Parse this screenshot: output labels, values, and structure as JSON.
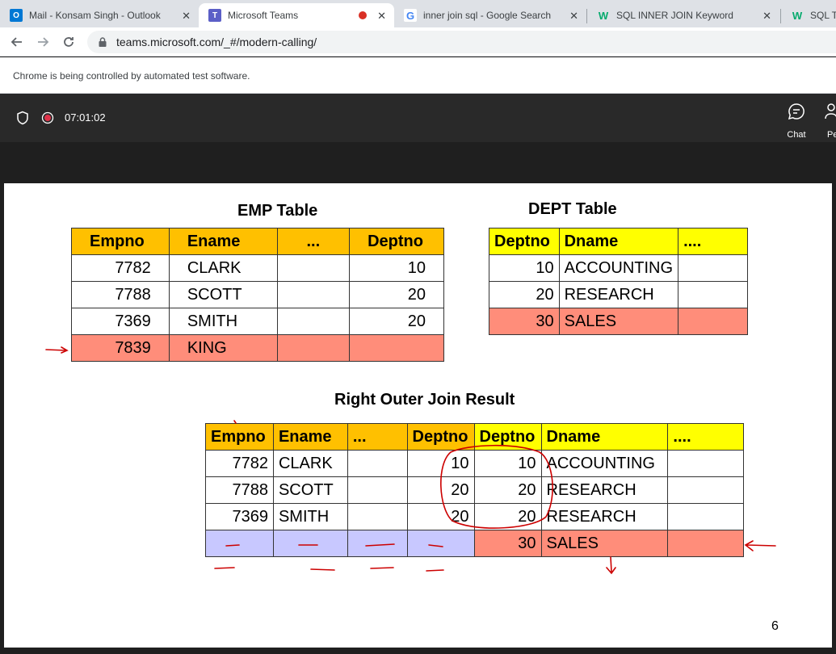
{
  "browser": {
    "tabs": [
      {
        "title": "Mail - Konsam Singh - Outlook",
        "icon": "outlook-icon",
        "color": "#0078d4"
      },
      {
        "title": "Microsoft Teams",
        "icon": "teams-icon",
        "color": "#5b5fc7",
        "active": true,
        "recording": true
      },
      {
        "title": "inner join sql - Google Search",
        "icon": "google-icon"
      },
      {
        "title": "SQL INNER JOIN Keyword",
        "icon": "w3schools-icon",
        "color": "#04aa6d"
      },
      {
        "title": "SQL Tr",
        "icon": "w3schools-icon",
        "color": "#04aa6d"
      }
    ],
    "close_glyph": "✕",
    "url": "teams.microsoft.com/_#/modern-calling/",
    "infobar": "Chrome is being controlled by automated test software."
  },
  "call": {
    "timer": "07:01:02",
    "chat_label": "Chat",
    "people_label": "Pe"
  },
  "slide": {
    "emp_title": "EMP Table",
    "emp_headers": [
      "Empno",
      "Ename",
      "...",
      "Deptno"
    ],
    "emp_rows": [
      [
        "7782",
        "CLARK",
        "",
        "10"
      ],
      [
        "7788",
        "SCOTT",
        "",
        "20"
      ],
      [
        "7369",
        "SMITH",
        "",
        "20"
      ],
      [
        "7839",
        "KING",
        "",
        ""
      ]
    ],
    "dept_title": "DEPT Table",
    "dept_headers": [
      "Deptno",
      "Dname",
      "...."
    ],
    "dept_rows": [
      [
        "10",
        "ACCOUNTING",
        ""
      ],
      [
        "20",
        "RESEARCH",
        ""
      ],
      [
        "30",
        "SALES",
        ""
      ]
    ],
    "result_title": "Right Outer Join Result",
    "result_headers": [
      "Empno",
      "Ename",
      "...",
      "Deptno",
      "Deptno",
      "Dname",
      "...."
    ],
    "result_rows": [
      [
        "7782",
        "CLARK",
        "",
        "10",
        "10",
        "ACCOUNTING",
        ""
      ],
      [
        "7788",
        "SCOTT",
        "",
        "20",
        "20",
        "RESEARCH",
        ""
      ],
      [
        "7369",
        "SMITH",
        "",
        "20",
        "20",
        "RESEARCH",
        ""
      ],
      [
        "",
        "",
        "",
        "",
        "30",
        "SALES",
        ""
      ]
    ],
    "page_number": "6",
    "colors": {
      "header_orange": "#ffc000",
      "header_yellow": "#ffff00",
      "highlight_salmon": "#ff8d7a",
      "null_lavender": "#c8c8ff",
      "ink_red": "#cc0000"
    }
  }
}
